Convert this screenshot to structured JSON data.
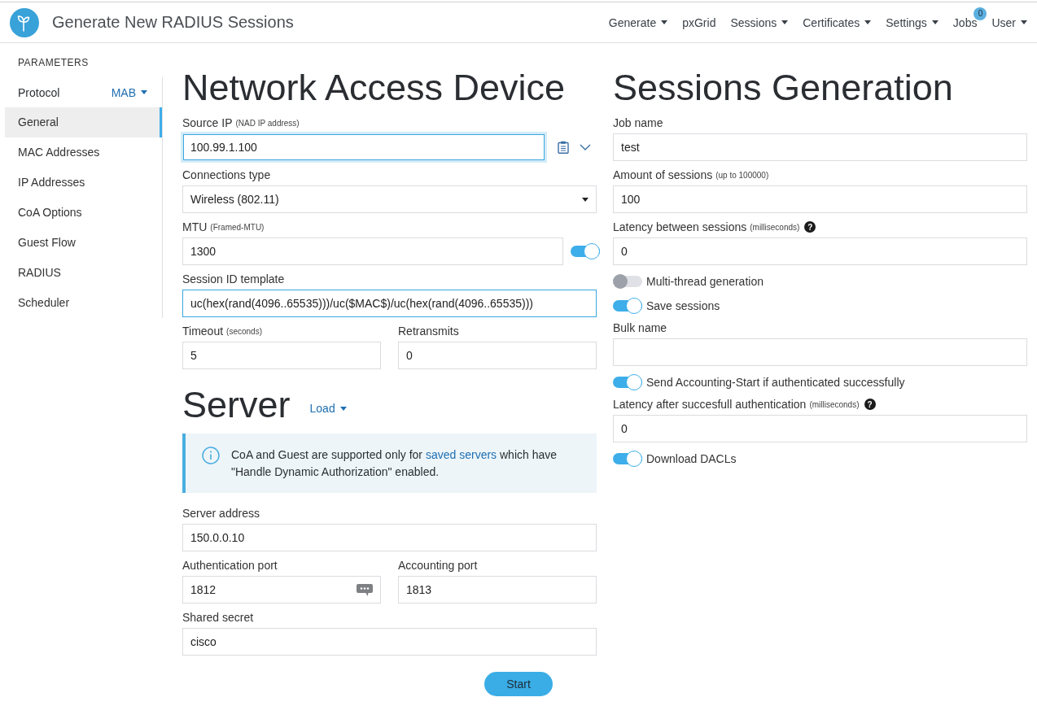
{
  "header": {
    "title": "Generate New RADIUS Sessions",
    "nav": [
      {
        "label": "Generate",
        "dropdown": true
      },
      {
        "label": "pxGrid",
        "dropdown": false
      },
      {
        "label": "Sessions",
        "dropdown": true
      },
      {
        "label": "Certificates",
        "dropdown": true
      },
      {
        "label": "Settings",
        "dropdown": true
      },
      {
        "label": "Jobs",
        "dropdown": false,
        "badge": "0"
      },
      {
        "label": "User",
        "dropdown": true
      }
    ]
  },
  "sidebar": {
    "heading": "PARAMETERS",
    "protocol": {
      "label": "Protocol",
      "value": "MAB"
    },
    "items": [
      {
        "label": "General",
        "selected": true
      },
      {
        "label": "MAC Addresses",
        "selected": false
      },
      {
        "label": "IP Addresses",
        "selected": false
      },
      {
        "label": "CoA Options",
        "selected": false
      },
      {
        "label": "Guest Flow",
        "selected": false
      },
      {
        "label": "RADIUS",
        "selected": false
      },
      {
        "label": "Scheduler",
        "selected": false
      }
    ]
  },
  "nad": {
    "title": "Network Access Device",
    "fields": [
      {
        "kind": "input-actions",
        "label": "Source IP",
        "hint": "(NAD IP address)",
        "value": "100.99.1.100",
        "focused": true,
        "highlighted": true
      },
      {
        "kind": "select",
        "label": "Connections type",
        "value": "Wireless (802.11)",
        "focused": false,
        "highlighted": false
      },
      {
        "kind": "input-toggle",
        "label": "MTU",
        "hint": "(Framed-MTU)",
        "value": "1300",
        "focused": false,
        "highlighted": false,
        "on": true
      },
      {
        "kind": "input",
        "label": "Session ID template",
        "value": "uc(hex(rand(4096..65535)))/uc($MAC$)/uc(hex(rand(4096..65535)))",
        "focused": false,
        "highlighted": true
      },
      {
        "kind": "pair",
        "fields": [
          {
            "kind": "input",
            "label": "Timeout",
            "hint": "(seconds)",
            "value": "5",
            "focused": false,
            "highlighted": false
          },
          {
            "kind": "input",
            "label": "Retransmits",
            "value": "0",
            "focused": false,
            "highlighted": false
          }
        ]
      }
    ]
  },
  "server": {
    "title": "Server",
    "load": "Load",
    "notice": {
      "before": "CoA and Guest are supported only for ",
      "link": "saved servers",
      "after": " which have \"Handle Dynamic Authorization\" enabled."
    },
    "fields": [
      {
        "kind": "input",
        "label": "Server address",
        "value": "150.0.0.10",
        "focused": false,
        "highlighted": false
      },
      {
        "kind": "pair",
        "fields": [
          {
            "kind": "input-icon",
            "label": "Authentication port",
            "value": "1812",
            "focused": false,
            "highlighted": false
          },
          {
            "kind": "input",
            "label": "Accounting port",
            "value": "1813",
            "focused": false,
            "highlighted": false
          }
        ]
      },
      {
        "kind": "input",
        "label": "Shared secret",
        "value": "cisco",
        "focused": false,
        "highlighted": false
      }
    ]
  },
  "generation": {
    "title": "Sessions Generation",
    "fields": [
      {
        "kind": "input",
        "label": "Job name",
        "value": "test",
        "focused": false,
        "highlighted": false
      },
      {
        "kind": "input",
        "label": "Amount of sessions",
        "hint": "(up to 100000)",
        "value": "100",
        "focused": false,
        "highlighted": false
      },
      {
        "kind": "input",
        "label": "Latency between sessions",
        "hint": "(milliseconds)",
        "help": "?",
        "value": "0",
        "focused": false,
        "highlighted": false
      },
      {
        "kind": "switch",
        "label": "Multi-thread generation",
        "on": false
      },
      {
        "kind": "switch",
        "label": "Save sessions",
        "on": true
      },
      {
        "kind": "input",
        "label": "Bulk name",
        "focused": false,
        "highlighted": false
      },
      {
        "kind": "switch",
        "label": "Send Accounting-Start if authenticated successfully",
        "on": true
      },
      {
        "kind": "input",
        "label": "Latency after succesfull authentication",
        "hint": "(milliseconds)",
        "help": "?",
        "value": "0",
        "focused": false,
        "highlighted": false
      },
      {
        "kind": "switch",
        "label": "Download DACLs",
        "on": true
      }
    ]
  },
  "start_button": "Start"
}
